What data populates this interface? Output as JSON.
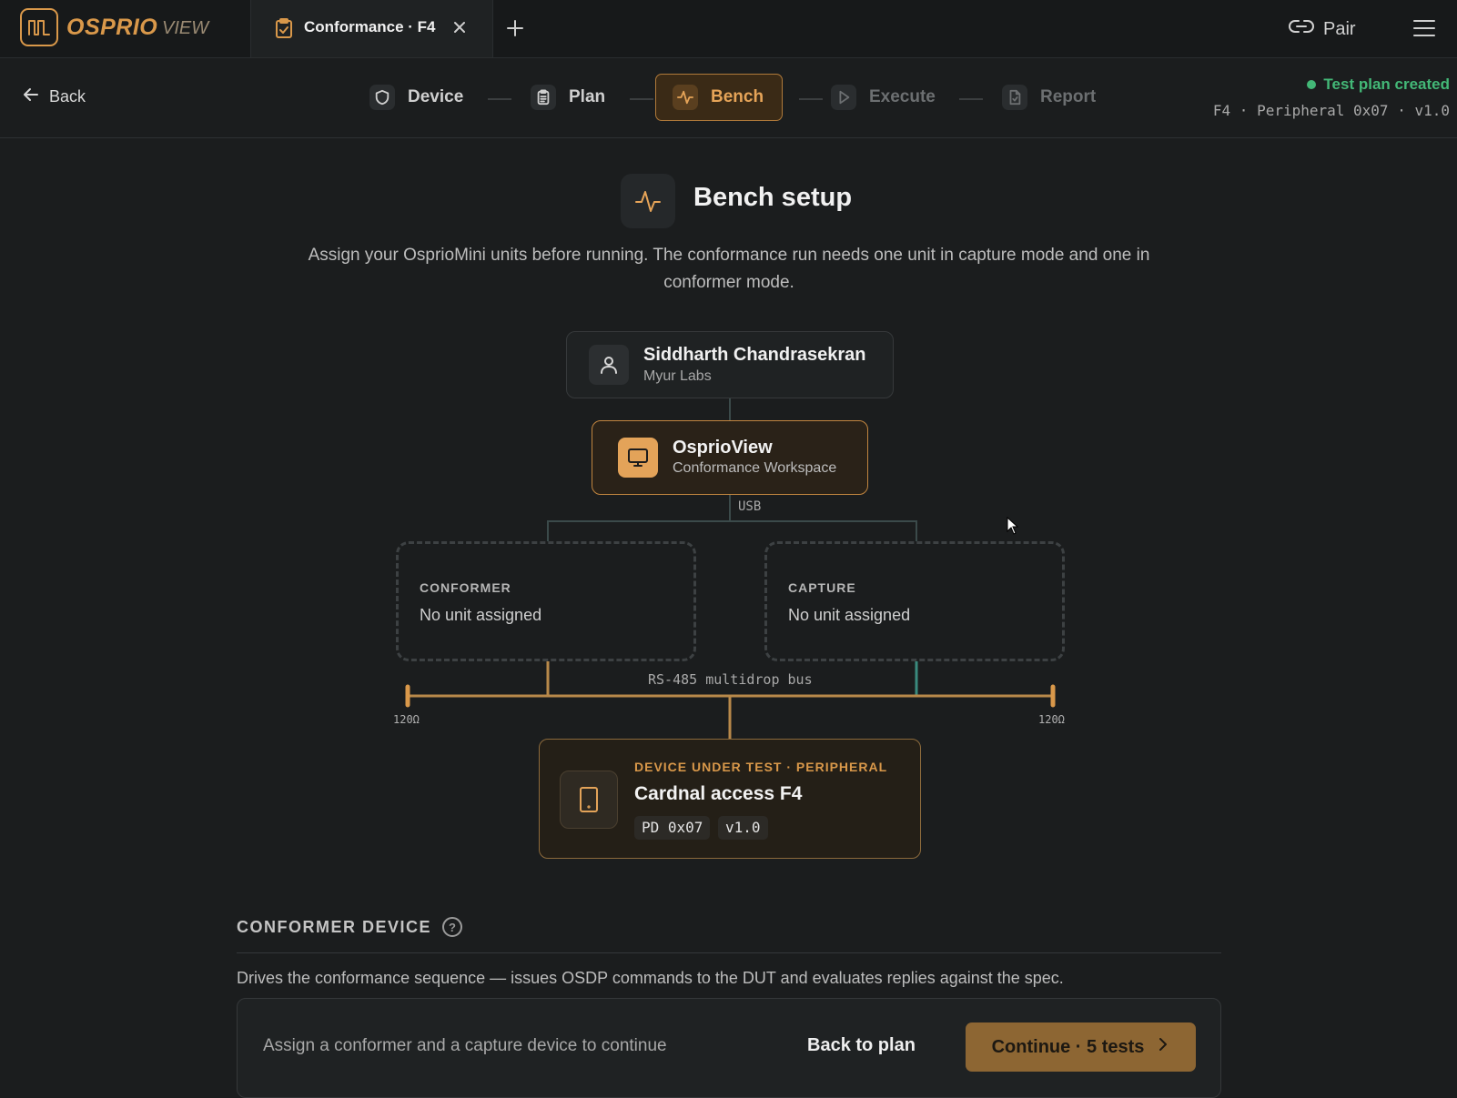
{
  "app": {
    "logo_text": "OSPRIO",
    "logo_suffix": "VIEW",
    "logo_icon": "waveform-icon"
  },
  "tab": {
    "label": "Conformance · F4",
    "icon": "clipboard-icon"
  },
  "topbar": {
    "pair_label": "Pair"
  },
  "stepbar": {
    "back_label": "Back",
    "steps": [
      {
        "label": "Device",
        "icon": "shield-icon",
        "state": "done"
      },
      {
        "label": "Plan",
        "icon": "clipboard-icon",
        "state": "done"
      },
      {
        "label": "Bench",
        "icon": "activity-icon",
        "state": "active"
      },
      {
        "label": "Execute",
        "icon": "play-icon",
        "state": "future"
      },
      {
        "label": "Report",
        "icon": "file-icon",
        "state": "future"
      }
    ],
    "status": "Test plan created",
    "meta": "F4 · Peripheral 0x07 · v1.0"
  },
  "page": {
    "title": "Bench setup",
    "intro": "Assign your OsprioMini units before running. The conformance run needs one unit in capture mode and one in conformer mode."
  },
  "diagram": {
    "user": {
      "name": "Siddharth Chandrasekran",
      "org": "Myur Labs"
    },
    "app": {
      "name": "OsprioView",
      "subtitle": "Conformance Workspace"
    },
    "usb_label": "USB",
    "conformer": {
      "title": "CONFORMER",
      "value": "No unit assigned"
    },
    "capture": {
      "title": "CAPTURE",
      "value": "No unit assigned"
    },
    "bus_label": "RS-485 multidrop bus",
    "termination_left": "120Ω",
    "termination_right": "120Ω",
    "dut": {
      "kicker": "DEVICE UNDER TEST · PERIPHERAL",
      "name": "Cardnal access F4",
      "address": "PD 0x07",
      "version": "v1.0"
    }
  },
  "section": {
    "title": "CONFORMER DEVICE",
    "description": "Drives the conformance sequence — issues OSDP commands to the DUT and evaluates replies against the spec."
  },
  "footer": {
    "hint": "Assign a conformer and a capture device to continue",
    "back_label": "Back to plan",
    "continue_label": "Continue · 5 tests"
  },
  "colors": {
    "accent": "#d9984a",
    "success": "#43b877",
    "background": "#1b1d1e",
    "bus": "#b8894a",
    "capture_wire": "#3a8a7e"
  }
}
